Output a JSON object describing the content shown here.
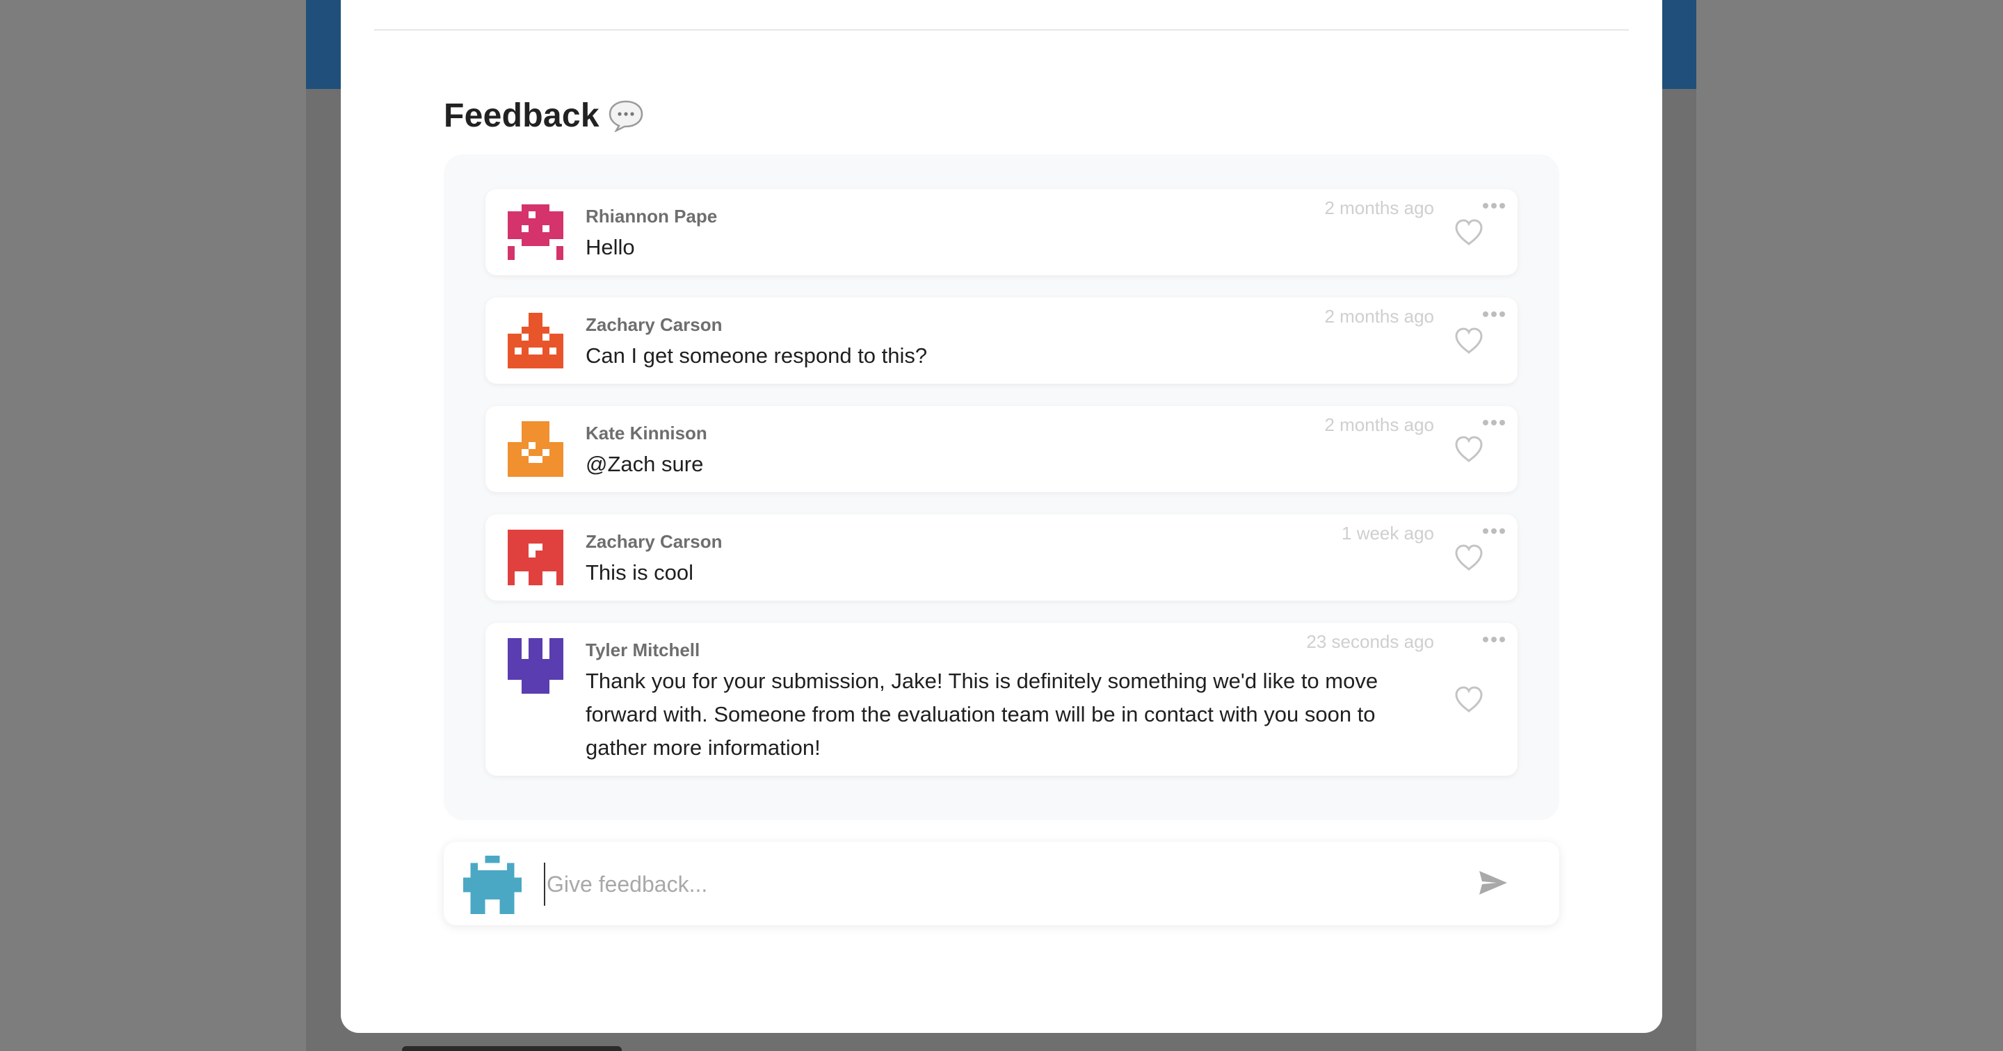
{
  "modal": {
    "title": "Feedback",
    "title_icon": "speech-bubble-icon"
  },
  "comments": [
    {
      "author": "Rhiannon Pape",
      "text": "Hello",
      "time": "2 months ago",
      "avatar_color": "#d4336b"
    },
    {
      "author": "Zachary Carson",
      "text": "Can I get someone respond to this?",
      "time": "2 months ago",
      "avatar_color": "#e8552a"
    },
    {
      "author": "Kate Kinnison",
      "text": "@Zach sure",
      "time": "2 months ago",
      "avatar_color": "#f0902f"
    },
    {
      "author": "Zachary Carson",
      "text": "This is cool",
      "time": "1 week ago",
      "avatar_color": "#e0413f"
    },
    {
      "author": "Tyler Mitchell",
      "text": "Thank you for your submission, Jake! This is definitely something we'd like to move forward with. Someone from the evaluation team will be in contact with you soon to gather more information!",
      "time": "23 seconds ago",
      "avatar_color": "#5a3db0"
    }
  ],
  "composer": {
    "value": "",
    "placeholder": "Give feedback...",
    "avatar_color": "#4aa8c4"
  },
  "colors": {
    "overlay": "#7d7d7d",
    "banner": "#1f4f7a",
    "thread_bg": "#f8f9fa",
    "timestamp": "#cfcfcf",
    "icon_gray": "#bdbdbd"
  },
  "icons": {
    "more": "more-dots-icon",
    "like": "heart-outline-icon",
    "send": "send-icon"
  }
}
